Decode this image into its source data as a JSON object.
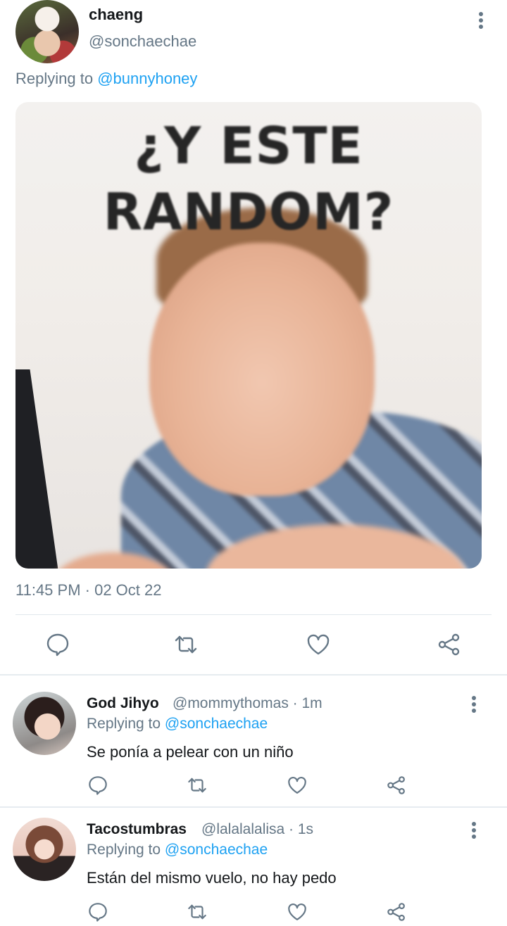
{
  "main_tweet": {
    "display_name": "chaeng",
    "handle": "@sonchaechae",
    "replying_prefix": "Replying to",
    "replying_to": "@bunnyhoney",
    "image_text_line1": "¿Y ESTE",
    "image_text_line2": "RANDOM?",
    "timestamp": "11:45 PM · 02 Oct 22"
  },
  "replies": [
    {
      "display_name": "God Jihyo",
      "meta": "@mommythomas · 1m",
      "replying_prefix": "Replying to",
      "replying_to": "@sonchaechae",
      "text": "Se ponía a pelear con un niño"
    },
    {
      "display_name": "Tacostumbras",
      "meta": "@lalalalalisa · 1s",
      "replying_prefix": "Replying to",
      "replying_to": "@sonchaechae",
      "text": "Están del mismo vuelo, no hay pedo"
    }
  ],
  "icons": {
    "reply": "reply-icon",
    "retweet": "retweet-icon",
    "like": "like-icon",
    "share": "share-icon",
    "more": "more-vertical-icon"
  },
  "colors": {
    "link": "#1da1f2",
    "secondary_text": "#657786",
    "icon": "#657786",
    "divider": "#e1e8ed"
  }
}
